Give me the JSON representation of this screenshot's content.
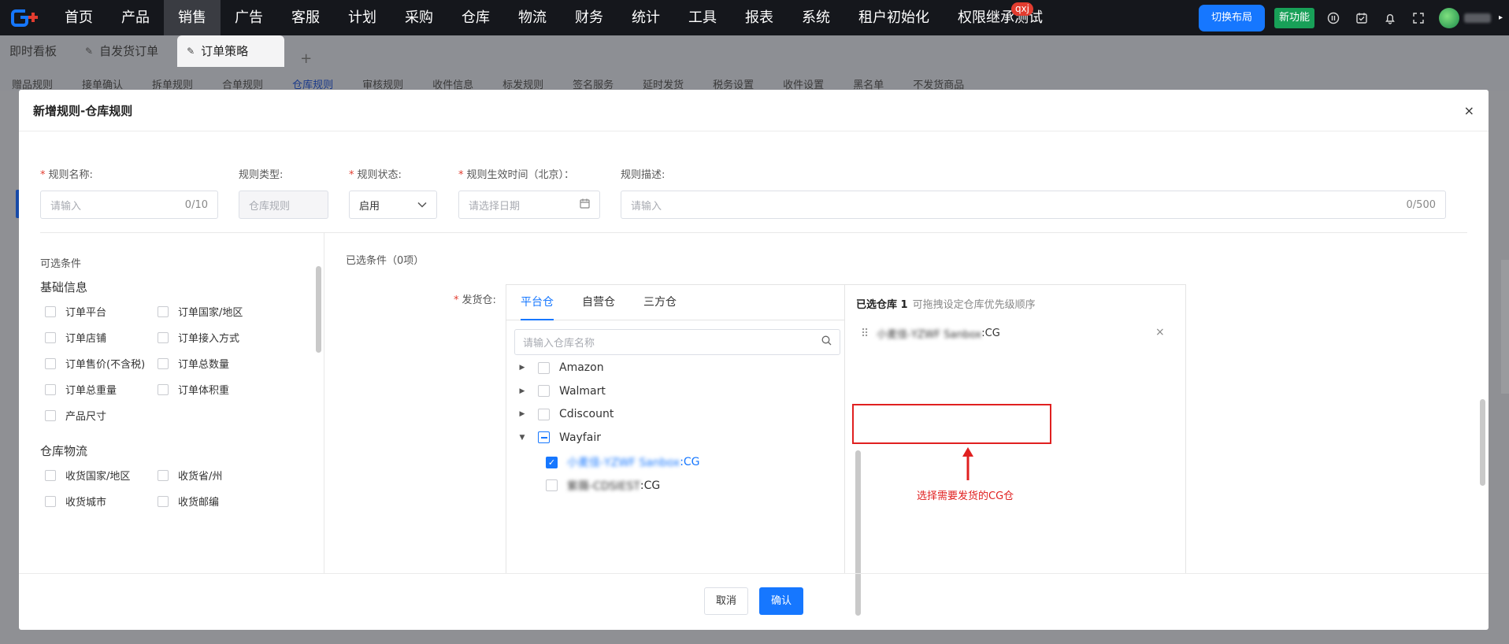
{
  "app": {
    "logo_text": "G+"
  },
  "topnav": {
    "items": [
      "首页",
      "产品",
      "销售",
      "广告",
      "客服",
      "计划",
      "采购",
      "仓库",
      "物流",
      "财务",
      "统计",
      "工具",
      "报表",
      "系统",
      "租户初始化",
      "权限继承测试"
    ],
    "active_index": 2,
    "badge": "qxj",
    "switch_layout_label": "切换布局",
    "new_feature_label": "新功能"
  },
  "tabs": {
    "items": [
      "即时看板",
      "自发货订单",
      "订单策略"
    ],
    "active_index": 2,
    "add": "+"
  },
  "subtabs": {
    "items": [
      "赠品规则",
      "接单确认",
      "拆单规则",
      "合单规则",
      "仓库规则",
      "审核规则",
      "收件信息",
      "标发规则",
      "签名服务",
      "延时发货",
      "税务设置",
      "收件设置",
      "黑名单",
      "不发货商品"
    ],
    "active_index": 4
  },
  "dialog": {
    "title": "新增规则-仓库规则",
    "close": "×",
    "form": {
      "rule_name": {
        "label": "规则名称:",
        "placeholder": "请输入",
        "counter": "0/10",
        "required": true
      },
      "rule_type": {
        "label": "规则类型:",
        "value": "仓库规则"
      },
      "rule_status": {
        "label": "规则状态:",
        "value": "启用",
        "required": true
      },
      "rule_time": {
        "label": "规则生效时间（北京）：",
        "placeholder": "请选择日期",
        "required": true
      },
      "rule_desc": {
        "label": "规则描述:",
        "placeholder": "请输入",
        "counter": "0/500"
      }
    },
    "left_panel": {
      "title": "可选条件",
      "sections": [
        {
          "title": "基础信息",
          "items": [
            "订单平台",
            "订单国家/地区",
            "订单店铺",
            "订单接入方式",
            "订单售价(不含税)",
            "订单总数量",
            "订单总重量",
            "订单体积重",
            "产品尺寸"
          ]
        },
        {
          "title": "仓库物流",
          "items": [
            "收货国家/地区",
            "收货省/州",
            "收货城市",
            "收货邮编"
          ]
        }
      ]
    },
    "right_panel": {
      "selected_title": "已选条件（0项）",
      "ship_label": "发货仓:",
      "warehouse_tabs": [
        "平台仓",
        "自营仓",
        "三方仓"
      ],
      "warehouse_active_tab": 0,
      "search_placeholder": "请输入仓库名称",
      "tree": [
        {
          "name": "Amazon",
          "expanded": false,
          "state": "unchecked"
        },
        {
          "name": "Walmart",
          "expanded": false,
          "state": "unchecked"
        },
        {
          "name": "Cdiscount",
          "expanded": false,
          "state": "unchecked"
        },
        {
          "name": "Wayfair",
          "expanded": true,
          "state": "indeterminate",
          "children": [
            {
              "name_prefix": "小麦佳-YZWF Sanbox",
              "suffix": ":CG",
              "checked": true
            },
            {
              "name_prefix": "紫薇-CDSIEST",
              "suffix": ":CG",
              "checked": false
            }
          ]
        }
      ],
      "selected_warehouse": {
        "title": "已选仓库 1",
        "hint": "可拖拽设定仓库优先级顺序",
        "items": [
          {
            "name_prefix": "小麦佳-YZWF Sanbox",
            "suffix": ":CG"
          }
        ],
        "remove": "×"
      },
      "annotation": "选择需要发货的CG仓"
    },
    "footer": {
      "cancel": "取消",
      "confirm": "确认"
    }
  },
  "colors": {
    "primary": "#1677ff",
    "nav_bg": "#15171c",
    "required": "#e23c2f",
    "annotation": "#e02020",
    "new_feature": "#18a058"
  }
}
